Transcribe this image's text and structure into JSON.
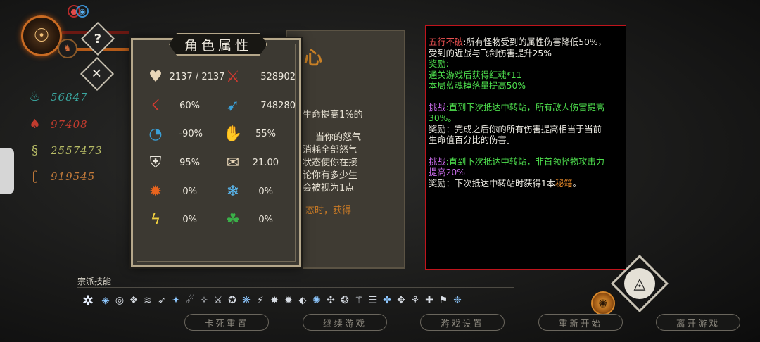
{
  "hud": {
    "portrait_icon": "sun-medallion-icon",
    "pet_icon": "beast-icon",
    "help_label": "?",
    "close_label": "✕"
  },
  "currencies": [
    {
      "icon": "flame-spirit-icon",
      "value": "56847",
      "color": "#3aa7a0"
    },
    {
      "icon": "fire-icon",
      "value": "97408",
      "color": "#c23b2e"
    },
    {
      "icon": "serpent-icon",
      "value": "2557473",
      "color": "#b8bd66"
    },
    {
      "icon": "spiral-icon",
      "value": "919545",
      "color": "#c27a3a"
    }
  ],
  "parchment": {
    "title": "心",
    "lines": [
      "生命提高1%的",
      "当你的怒气",
      "消耗全部怒气",
      "状态使你在接",
      "论你有多少生",
      "会被视为1点"
    ],
    "highlight": "态时，获得"
  },
  "attributes": {
    "title": "角色属性",
    "stats": [
      {
        "icon": "heart-icon",
        "value": "2137 / 2137",
        "color": "#e8d6b8"
      },
      {
        "icon": "sword-attack-icon",
        "value": "528902",
        "color": "#d83a30"
      },
      {
        "icon": "crit-claw-icon",
        "value": "60%",
        "color": "#d83a30"
      },
      {
        "icon": "crit-damage-icon",
        "value": "748280",
        "color": "#3aa0d8"
      },
      {
        "icon": "cooldown-icon",
        "value": "-90%",
        "color": "#3aa0d8"
      },
      {
        "icon": "dodge-icon",
        "value": "55%",
        "color": "#e8d6b8"
      },
      {
        "icon": "shield-icon",
        "value": "95%",
        "color": "#e8e4da"
      },
      {
        "icon": "scroll-icon",
        "value": "21.00",
        "color": "#e8d6b8"
      },
      {
        "icon": "fire-icon",
        "value": "0%",
        "color": "#e8641e"
      },
      {
        "icon": "ice-icon",
        "value": "0%",
        "color": "#5ab8f0"
      },
      {
        "icon": "lightning-icon",
        "value": "0%",
        "color": "#f0d040"
      },
      {
        "icon": "poison-icon",
        "value": "0%",
        "color": "#3ab048"
      }
    ]
  },
  "description": {
    "block1_label": "五行不破",
    "block1_text": ":所有怪物受到的属性伤害降低50%，",
    "block1_line2": "受到的近战与飞剑伤害提升25%",
    "block1_reward_label": "奖励:",
    "block1_reward1": "通关游戏后获得红魂*11",
    "block1_reward2": "本局蓝魂掉落量提高50%",
    "block2_label": "挑战",
    "block2_text": ":直到下次抵达中转站，所有敌人伤害提高",
    "block2_line2": "30%。",
    "block2_reward": "奖励：完成之后你的所有伤害提高相当于当前",
    "block2_reward2": "生命值百分比的伤害。",
    "block3_label": "挑战",
    "block3_text": ":直到下次抵达中转站，非首领怪物攻击力",
    "block3_line2": "提高20%",
    "block3_reward_a": "奖励：下次抵达中转站时获得1本",
    "block3_reward_b": "秘籍",
    "block3_reward_c": "。"
  },
  "skills": {
    "label": "宗派技能",
    "icons": [
      "✲",
      "◈",
      "◎",
      "❖",
      "≋",
      "➶",
      "✦",
      "☄",
      "✧",
      "⚔",
      "✪",
      "❋",
      "⚡",
      "✸",
      "✹",
      "⬖",
      "✺",
      "✣",
      "❂",
      "⚚",
      "☰",
      "✤",
      "✥",
      "⚘",
      "✚",
      "⚑",
      "❉"
    ]
  },
  "buttons": {
    "restart_stuck": "卡死重置",
    "continue": "继续游戏",
    "settings": "游戏设置",
    "restart": "重新开始",
    "leave": "离开游戏"
  }
}
